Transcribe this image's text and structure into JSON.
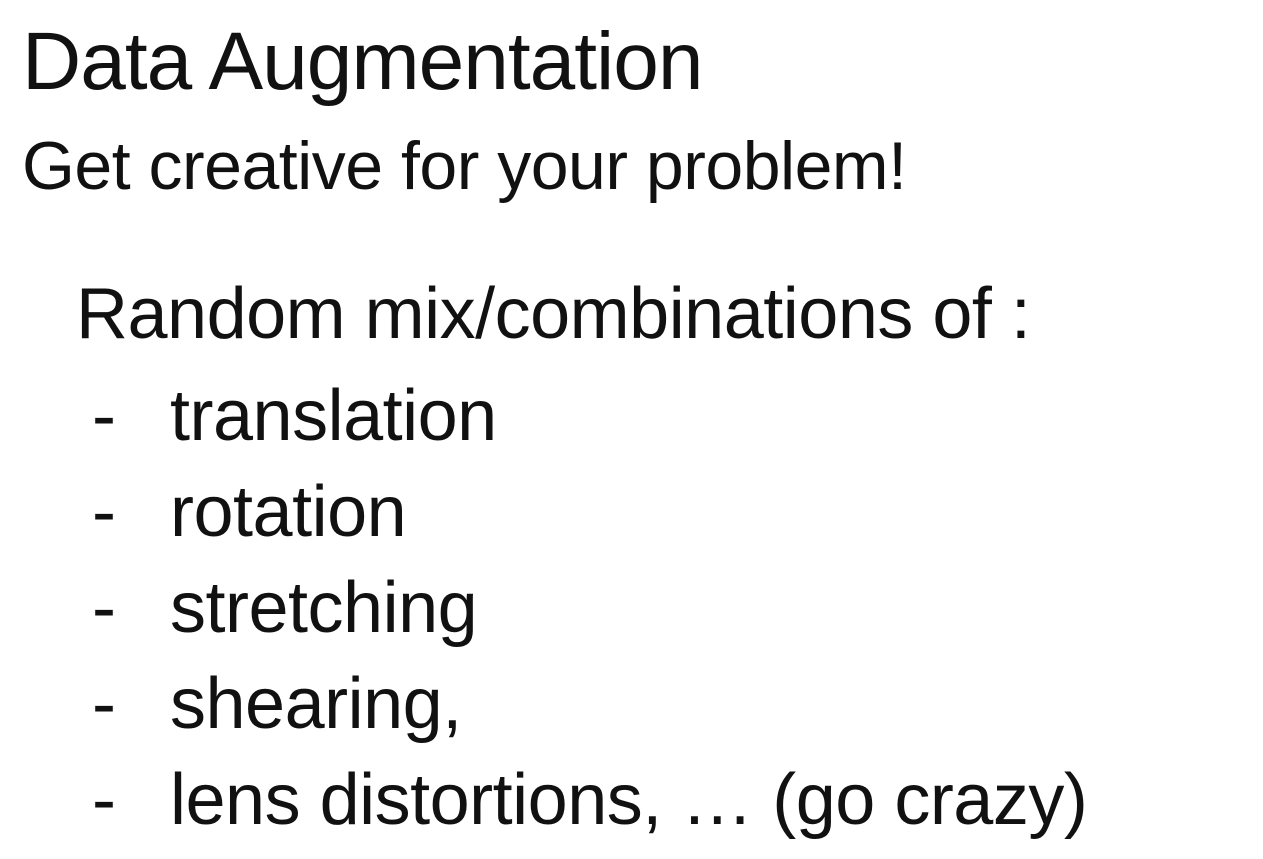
{
  "slide": {
    "title": "Data Augmentation",
    "subtitle": "Get creative for your problem!",
    "intro": "Random mix/combinations of :",
    "bullet_marker": "-",
    "items": [
      "translation",
      "rotation",
      "stretching",
      "shearing,",
      "lens distortions, …  (go crazy)"
    ]
  }
}
